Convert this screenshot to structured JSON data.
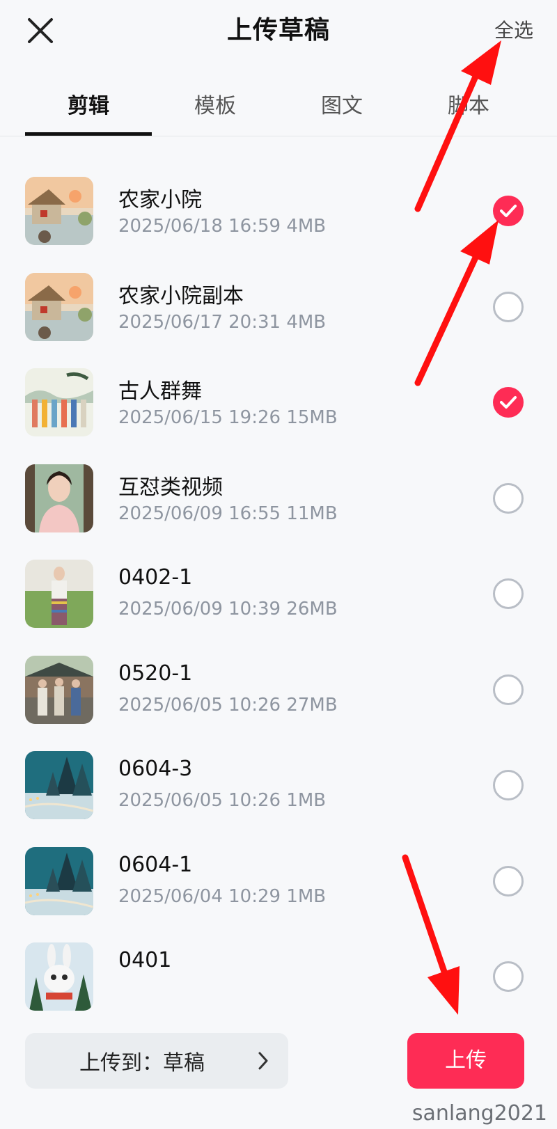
{
  "header": {
    "title": "上传草稿",
    "select_all": "全选"
  },
  "tabs": [
    {
      "label": "剪辑",
      "active": true
    },
    {
      "label": "模板",
      "active": false
    },
    {
      "label": "图文",
      "active": false
    },
    {
      "label": "脚本",
      "active": false
    }
  ],
  "drafts": [
    {
      "name": "农家小院",
      "meta": "2025/06/18 16:59 4MB",
      "checked": true,
      "thumb": "farmhouse"
    },
    {
      "name": "农家小院副本",
      "meta": "2025/06/17 20:31 4MB",
      "checked": false,
      "thumb": "farmhouse"
    },
    {
      "name": "古人群舞",
      "meta": "2025/06/15 19:26 15MB",
      "checked": true,
      "thumb": "dancers"
    },
    {
      "name": "互怼类视频",
      "meta": "2025/06/09 16:55 11MB",
      "checked": false,
      "thumb": "portrait"
    },
    {
      "name": "0402-1",
      "meta": "2025/06/09 10:39 26MB",
      "checked": false,
      "thumb": "meadow"
    },
    {
      "name": "0520-1",
      "meta": "2025/06/05 10:26 27MB",
      "checked": false,
      "thumb": "village"
    },
    {
      "name": "0604-3",
      "meta": "2025/06/05 10:26 1MB",
      "checked": false,
      "thumb": "snow-forest"
    },
    {
      "name": "0604-1",
      "meta": "2025/06/04 10:29 1MB",
      "checked": false,
      "thumb": "snow-forest"
    },
    {
      "name": "0401",
      "meta": "",
      "checked": false,
      "thumb": "rabbit"
    }
  ],
  "bottom": {
    "destination_label": "上传到：草稿",
    "upload_label": "上传"
  },
  "watermark": "sanlang2021",
  "colors": {
    "accent": "#fe2c55",
    "annotation_arrow": "#ff1010",
    "meta_text": "#8e95a0"
  }
}
